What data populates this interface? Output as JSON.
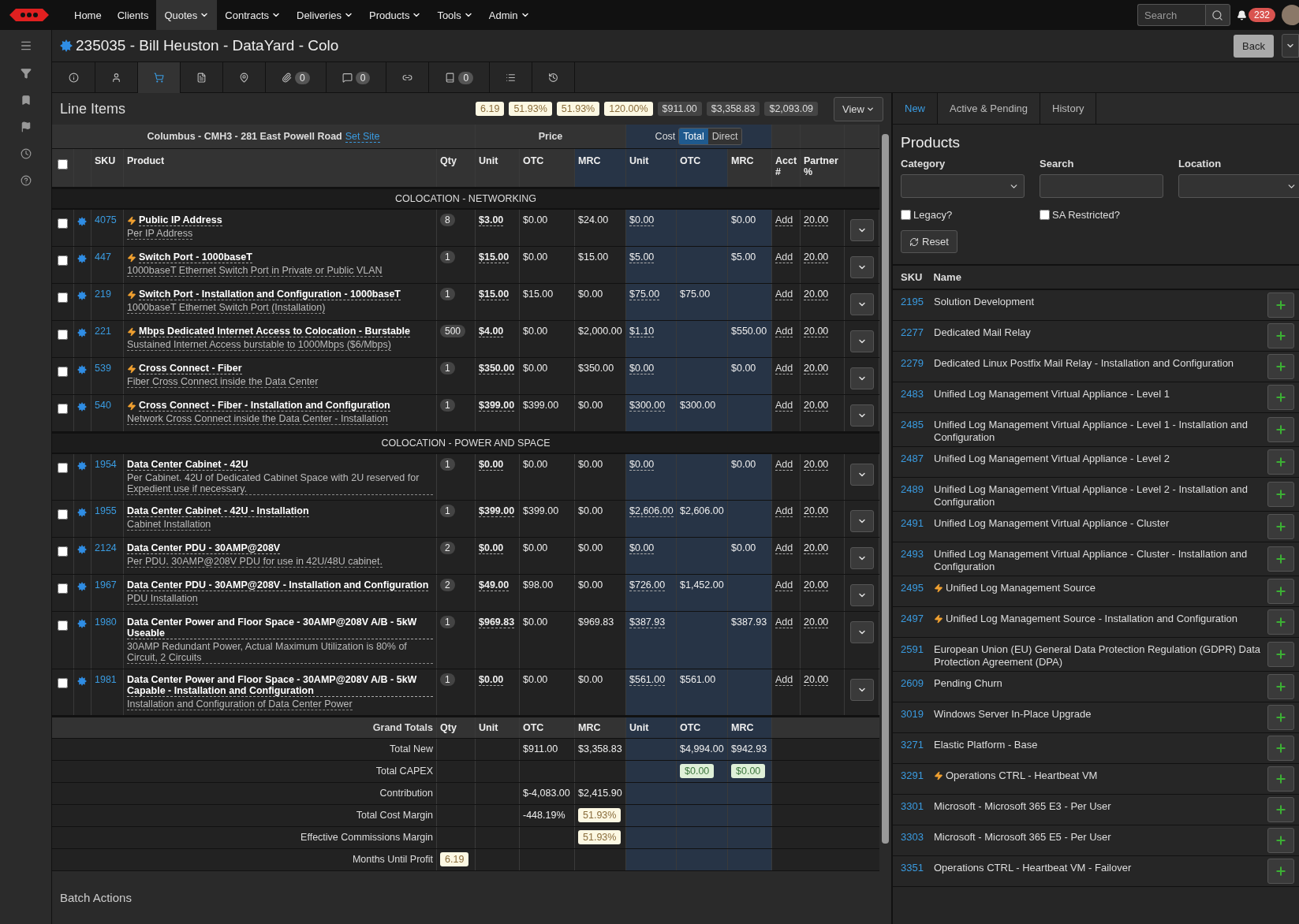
{
  "nav": {
    "menu": [
      {
        "label": "Home",
        "caret": false,
        "selected": false
      },
      {
        "label": "Clients",
        "caret": false,
        "selected": false
      },
      {
        "label": "Quotes",
        "caret": true,
        "selected": true
      },
      {
        "label": "Contracts",
        "caret": true,
        "selected": false
      },
      {
        "label": "Deliveries",
        "caret": true,
        "selected": false
      },
      {
        "label": "Products",
        "caret": true,
        "selected": false
      },
      {
        "label": "Tools",
        "caret": true,
        "selected": false
      },
      {
        "label": "Admin",
        "caret": true,
        "selected": false
      }
    ],
    "search": {
      "placeholder": "Search"
    },
    "notifications": "232"
  },
  "title": "235035 - Bill Heuston - DataYard - Colo",
  "back_button": "Back",
  "tabs": [
    {
      "selected": false
    },
    {
      "selected": false
    },
    {
      "selected": true
    },
    {
      "selected": false
    },
    {
      "selected": false
    },
    {
      "count": "0",
      "selected": false
    },
    {
      "count": "0",
      "selected": false
    },
    {
      "selected": false
    },
    {
      "count": "0",
      "selected": false
    },
    {
      "selected": false
    },
    {
      "selected": false
    }
  ],
  "line_items": {
    "title": "Line Items",
    "summary": [
      {
        "text": "6.19",
        "kind": "highlight"
      },
      {
        "text": "51.93%",
        "kind": "highlight"
      },
      {
        "text": "51.93%",
        "kind": "highlight"
      },
      {
        "text": "120.00%",
        "kind": "highlight"
      },
      {
        "text": "$911.00",
        "kind": "plain"
      },
      {
        "text": "$3,358.83",
        "kind": "plain"
      },
      {
        "text": "$2,093.09",
        "kind": "plain"
      }
    ],
    "view_button": "View",
    "site": "Columbus - CMH3 - 281 East Powell Road",
    "set_site": "Set Site",
    "price_header": "Price",
    "cost_header": "Cost",
    "cost_modes": [
      {
        "label": "Total",
        "selected": true
      },
      {
        "label": "Direct",
        "selected": false
      }
    ],
    "select_all": {
      "checked": false
    },
    "columns": [
      "SKU",
      "Product",
      "Qty",
      "Unit",
      "OTC",
      "MRC",
      "Unit",
      "OTC",
      "MRC",
      "Acct #",
      "Partner %"
    ],
    "sections": [
      {
        "title": "COLOCATION - NETWORKING",
        "rows": [
          {
            "checked": false,
            "sku": "4075",
            "flash": true,
            "name": "Public IP Address",
            "desc": "Per IP Address",
            "qty": "8",
            "unit": "$3.00",
            "otc": "$0.00",
            "mrc": "$24.00",
            "cost_unit": "$0.00",
            "cost_mrc": "$0.00",
            "acct": "Add",
            "partner": "20.00"
          },
          {
            "checked": false,
            "sku": "447",
            "flash": true,
            "name": "Switch Port - 1000baseT",
            "desc": "1000baseT Ethernet Switch Port in Private or Public VLAN",
            "qty": "1",
            "unit": "$15.00",
            "otc": "$0.00",
            "mrc": "$15.00",
            "cost_unit": "$5.00",
            "cost_mrc": "$5.00",
            "acct": "Add",
            "partner": "20.00"
          },
          {
            "checked": false,
            "sku": "219",
            "flash": true,
            "name": "Switch Port - Installation and Configuration - 1000baseT",
            "desc": "1000baseT Ethernet Switch Port (Installation)",
            "qty": "1",
            "unit": "$15.00",
            "otc": "$15.00",
            "mrc": "$0.00",
            "cost_unit": "$75.00",
            "cost_otc": "$75.00",
            "acct": "Add",
            "partner": "20.00"
          },
          {
            "checked": false,
            "sku": "221",
            "flash": true,
            "name": "Mbps Dedicated Internet Access to Colocation - Burstable",
            "desc": "Sustained Internet Access burstable to 1000Mbps ($6/Mbps)",
            "qty": "500",
            "unit": "$4.00",
            "otc": "$0.00",
            "mrc": "$2,000.00",
            "cost_unit": "$1.10",
            "cost_mrc": "$550.00",
            "acct": "Add",
            "partner": "20.00"
          },
          {
            "checked": false,
            "sku": "539",
            "flash": true,
            "name": "Cross Connect - Fiber",
            "desc": "Fiber Cross Connect inside the Data Center",
            "qty": "1",
            "unit": "$350.00",
            "otc": "$0.00",
            "mrc": "$350.00",
            "cost_unit": "$0.00",
            "cost_mrc": "$0.00",
            "acct": "Add",
            "partner": "20.00"
          },
          {
            "checked": false,
            "sku": "540",
            "flash": true,
            "name": "Cross Connect - Fiber -  Installation and Configuration",
            "desc": "Network Cross Connect inside the Data Center - Installation",
            "qty": "1",
            "unit": "$399.00",
            "otc": "$399.00",
            "mrc": "$0.00",
            "cost_unit": "$300.00",
            "cost_otc": "$300.00",
            "acct": "Add",
            "partner": "20.00"
          }
        ]
      },
      {
        "title": "COLOCATION - POWER AND SPACE",
        "rows": [
          {
            "checked": false,
            "sku": "1954",
            "flash": false,
            "name": "Data Center Cabinet - 42U",
            "desc": "Per Cabinet. 42U of Dedicated Cabinet Space with 2U reserved for Expedient use if necessary.",
            "qty": "1",
            "unit": "$0.00",
            "otc": "$0.00",
            "mrc": "$0.00",
            "cost_unit": "$0.00",
            "cost_mrc": "$0.00",
            "acct": "Add",
            "partner": "20.00"
          },
          {
            "checked": false,
            "sku": "1955",
            "flash": false,
            "name": "Data Center Cabinet - 42U - Installation",
            "desc": "Cabinet Installation",
            "qty": "1",
            "unit": "$399.00",
            "otc": "$399.00",
            "mrc": "$0.00",
            "cost_unit": "$2,606.00",
            "cost_otc": "$2,606.00",
            "acct": "Add",
            "partner": "20.00"
          },
          {
            "checked": false,
            "sku": "2124",
            "flash": false,
            "name": "Data Center PDU - 30AMP@208V",
            "desc": "Per PDU. 30AMP@208V PDU for use in 42U/48U cabinet.",
            "qty": "2",
            "unit": "$0.00",
            "otc": "$0.00",
            "mrc": "$0.00",
            "cost_unit": "$0.00",
            "cost_mrc": "$0.00",
            "acct": "Add",
            "partner": "20.00"
          },
          {
            "checked": false,
            "sku": "1967",
            "flash": false,
            "name": "Data Center PDU - 30AMP@208V - Installation and Configuration",
            "desc": "PDU Installation",
            "qty": "2",
            "unit": "$49.00",
            "otc": "$98.00",
            "mrc": "$0.00",
            "cost_unit": "$726.00",
            "cost_otc": "$1,452.00",
            "acct": "Add",
            "partner": "20.00"
          },
          {
            "checked": false,
            "sku": "1980",
            "flash": false,
            "name": "Data Center Power and Floor Space - 30AMP@208V A/B - 5kW Useable",
            "desc": "30AMP Redundant Power, Actual Maximum Utilization is 80% of Circuit, 2 Circuits",
            "qty": "1",
            "unit": "$969.83",
            "otc": "$0.00",
            "mrc": "$969.83",
            "cost_unit": "$387.93",
            "cost_mrc": "$387.93",
            "acct": "Add",
            "partner": "20.00"
          },
          {
            "checked": false,
            "sku": "1981",
            "flash": false,
            "name": "Data Center Power and Floor Space - 30AMP@208V A/B - 5kW Capable - Installation and Configuration",
            "desc": "Installation and Configuration of Data Center Power",
            "qty": "1",
            "unit": "$0.00",
            "otc": "$0.00",
            "mrc": "$0.00",
            "cost_unit": "$561.00",
            "cost_otc": "$561.00",
            "acct": "Add",
            "partner": "20.00"
          }
        ]
      }
    ],
    "totals": {
      "header": {
        "label": "Grand Totals",
        "qty": "Qty",
        "unit": "Unit",
        "otc": "OTC",
        "mrc": "MRC",
        "cost_unit": "Unit",
        "cost_otc": "OTC",
        "cost_mrc": "MRC"
      },
      "rows": [
        {
          "label": "Total New",
          "otc": {
            "text": "$911.00",
            "kind": "plain"
          },
          "mrc": {
            "text": "$3,358.83",
            "kind": "plain"
          },
          "cost_otc": {
            "text": "$4,994.00",
            "kind": "plain"
          },
          "cost_mrc": {
            "text": "$942.93",
            "kind": "plain"
          }
        },
        {
          "label": "Total CAPEX",
          "cost_otc": {
            "text": "$0.00",
            "kind": "success"
          },
          "cost_mrc": {
            "text": "$0.00",
            "kind": "success"
          }
        },
        {
          "label": "Contribution",
          "otc": {
            "text": "$-4,083.00",
            "kind": "plain"
          },
          "mrc": {
            "text": "$2,415.90",
            "kind": "plain"
          }
        },
        {
          "label": "Total Cost Margin",
          "otc": {
            "text": "-448.19%",
            "kind": "plain"
          },
          "mrc": {
            "text": "51.93%",
            "kind": "highlight"
          }
        },
        {
          "label": "Effective Commissions Margin",
          "mrc": {
            "text": "51.93%",
            "kind": "highlight"
          }
        },
        {
          "label": "Months Until Profit",
          "qty": {
            "text": "6.19",
            "kind": "highlight"
          }
        }
      ]
    },
    "batch_actions": "Batch Actions"
  },
  "products_panel": {
    "tabs": [
      {
        "label": "New",
        "selected": true
      },
      {
        "label": "Active & Pending",
        "selected": false
      },
      {
        "label": "History",
        "selected": false
      }
    ],
    "title": "Products",
    "filters": [
      {
        "label": "Category",
        "kind": "select"
      },
      {
        "label": "Search",
        "kind": "input"
      },
      {
        "label": "Location",
        "kind": "select"
      }
    ],
    "options": [
      {
        "label": "Legacy?",
        "checked": false
      },
      {
        "label": "SA Restricted?",
        "checked": false
      }
    ],
    "reset_button": "Reset",
    "columns": [
      "SKU",
      "Name"
    ],
    "rows": [
      {
        "sku": "2195",
        "flash": false,
        "name": "Solution Development"
      },
      {
        "sku": "2277",
        "flash": false,
        "name": "Dedicated Mail Relay"
      },
      {
        "sku": "2279",
        "flash": false,
        "name": "Dedicated Linux Postfix Mail Relay - Installation and Configuration"
      },
      {
        "sku": "2483",
        "flash": false,
        "name": "Unified Log Management Virtual Appliance - Level 1"
      },
      {
        "sku": "2485",
        "flash": false,
        "name": "Unified Log Management Virtual Appliance - Level 1 - Installation and Configuration"
      },
      {
        "sku": "2487",
        "flash": false,
        "name": "Unified Log Management Virtual Appliance - Level 2"
      },
      {
        "sku": "2489",
        "flash": false,
        "name": "Unified Log Management Virtual Appliance - Level 2 - Installation and Configuration"
      },
      {
        "sku": "2491",
        "flash": false,
        "name": "Unified Log Management Virtual Appliance - Cluster"
      },
      {
        "sku": "2493",
        "flash": false,
        "name": "Unified Log Management Virtual Appliance - Cluster - Installation and Configuration"
      },
      {
        "sku": "2495",
        "flash": true,
        "name": "Unified Log Management Source"
      },
      {
        "sku": "2497",
        "flash": true,
        "name": "Unified Log Management Source - Installation and Configuration"
      },
      {
        "sku": "2591",
        "flash": false,
        "name": "European Union (EU) General Data Protection Regulation (GDPR) Data Protection Agreement (DPA)"
      },
      {
        "sku": "2609",
        "flash": false,
        "name": "Pending Churn"
      },
      {
        "sku": "3019",
        "flash": false,
        "name": "Windows Server In-Place Upgrade"
      },
      {
        "sku": "3271",
        "flash": false,
        "name": "Elastic Platform - Base"
      },
      {
        "sku": "3291",
        "flash": true,
        "name": "Operations CTRL - Heartbeat VM"
      },
      {
        "sku": "3301",
        "flash": false,
        "name": "Microsoft - Microsoft 365 E3 - Per User"
      },
      {
        "sku": "3303",
        "flash": false,
        "name": "Microsoft - Microsoft 365 E5 - Per User"
      },
      {
        "sku": "3351",
        "flash": false,
        "name": "Operations CTRL - Heartbeat VM - Failover"
      }
    ]
  }
}
